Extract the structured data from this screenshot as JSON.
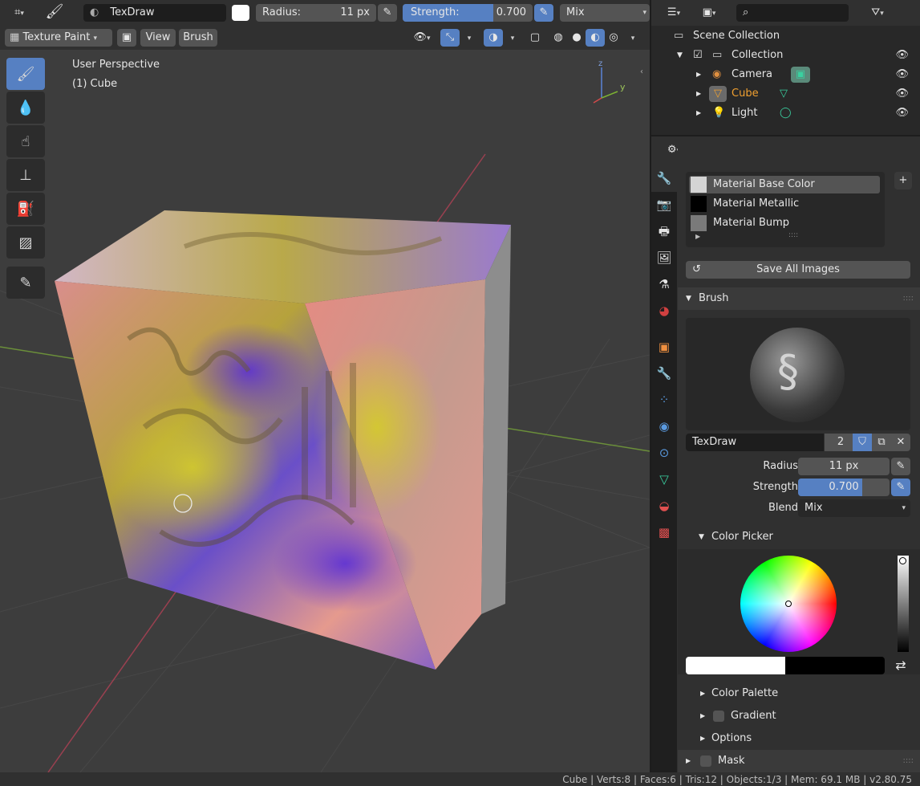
{
  "header": {
    "brush_name": "TexDraw",
    "radius_label": "Radius:",
    "radius_value": "11 px",
    "strength_label": "Strength:",
    "strength_value": "0.700",
    "strength_fraction": 0.7,
    "blend_value": "Mix",
    "mode_label": "Texture Paint",
    "menu_view": "View",
    "menu_brush": "Brush"
  },
  "viewport": {
    "perspective_label": "User Perspective",
    "object_label": "(1) Cube",
    "axis_z": "z",
    "axis_y": "y"
  },
  "outliner": {
    "scene_collection": "Scene Collection",
    "collection": "Collection",
    "items": [
      {
        "label": "Camera",
        "color": "#e6e6e6"
      },
      {
        "label": "Cube",
        "color": "#f0a030"
      },
      {
        "label": "Light",
        "color": "#e6e6e6"
      }
    ]
  },
  "properties": {
    "slots": [
      {
        "label": "Material Base Color",
        "swatch": "#d4d4d4"
      },
      {
        "label": "Material Metallic",
        "swatch": "#000000"
      },
      {
        "label": "Material Bump",
        "swatch": "#7a7a7a"
      }
    ],
    "save_all_images": "Save All Images",
    "brush_panel": "Brush",
    "brush_name": "TexDraw",
    "brush_users": "2",
    "radius_label": "Radius",
    "radius_value": "11 px",
    "strength_label": "Strength",
    "strength_value": "0.700",
    "strength_fraction": 0.7,
    "blend_label": "Blend",
    "blend_value": "Mix",
    "color_picker": "Color Picker",
    "color_palette": "Color Palette",
    "gradient": "Gradient",
    "options": "Options",
    "mask": "Mask",
    "primary_color": "#ffffff",
    "secondary_color": "#000000"
  },
  "status": "Cube | Verts:8 | Faces:6 | Tris:12 | Objects:1/3 | Mem: 69.1 MB | v2.80.75"
}
